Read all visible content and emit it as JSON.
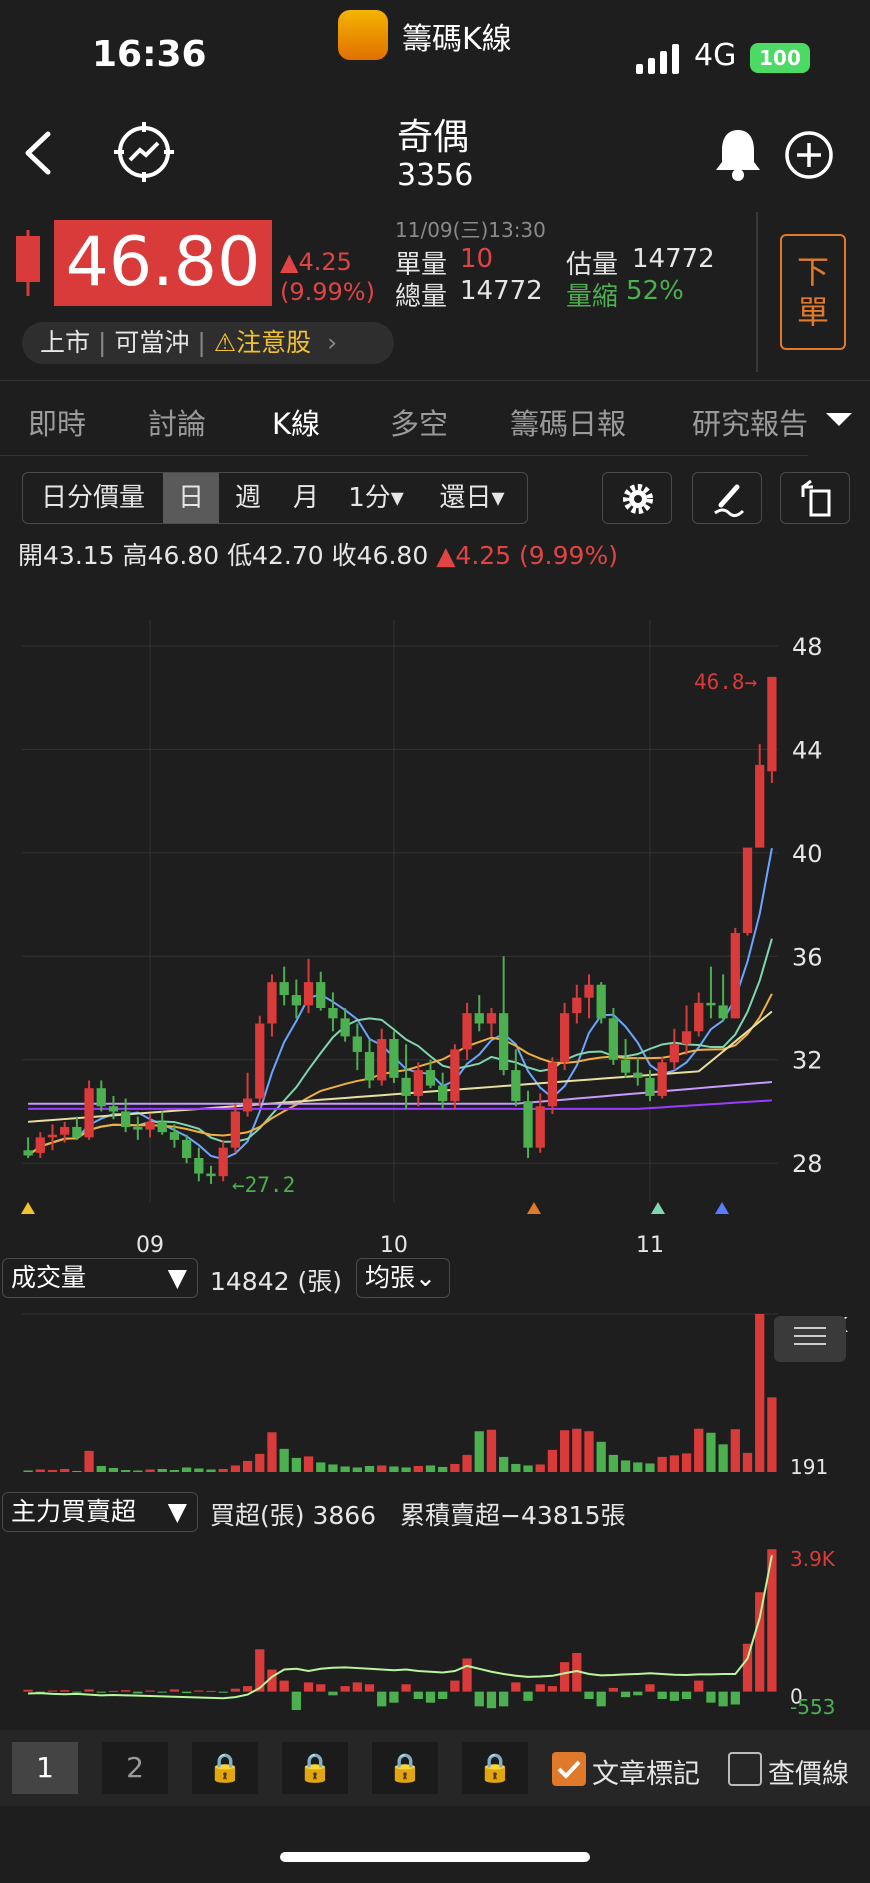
{
  "status_bar": {
    "time": "16:36",
    "app_name": "籌碼K線",
    "network": "4G",
    "battery": "100"
  },
  "header": {
    "stock_name": "奇偶",
    "stock_code": "3356"
  },
  "quote": {
    "price": "46.80",
    "change": "▲4.25",
    "change_pct": "(9.99%)",
    "datetime": "11/09(三)13:30",
    "single_volume_label": "單量",
    "single_volume": "10",
    "total_volume_label": "總量",
    "total_volume": "14772",
    "est_volume_label": "估量",
    "est_volume": "14772",
    "volume_shrink_label": "量縮",
    "volume_shrink": "52%",
    "order_button": "下單",
    "tags": [
      "上市",
      "可當沖",
      "注意股"
    ]
  },
  "tabs": [
    "即時",
    "討論",
    "K線",
    "多空",
    "籌碼日報",
    "研究報告"
  ],
  "active_tab": "K線",
  "toolbar": {
    "items": [
      "日分價量",
      "日",
      "週",
      "月",
      "1分▾",
      "還日▾"
    ],
    "selected": "日"
  },
  "ohlc": {
    "open_label": "開",
    "open": "43.15",
    "high_label": "高",
    "high": "46.80",
    "low_label": "低",
    "low": "42.70",
    "close_label": "收",
    "close": "46.80",
    "change": "▲4.25 (9.99%)"
  },
  "chart_data": [
    {
      "type": "candlestick",
      "y_ticks": [
        "48",
        "44",
        "40",
        "36",
        "32",
        "28"
      ],
      "x_ticks": [
        "09",
        "10",
        "11"
      ],
      "ylim": [
        26.5,
        49
      ],
      "max_label": "46.8",
      "min_label": "27.2",
      "ohlc": [
        [
          28.5,
          29.0,
          28.2,
          28.3
        ],
        [
          28.4,
          29.2,
          28.2,
          29.0
        ],
        [
          29.0,
          29.5,
          28.5,
          29.1
        ],
        [
          29.1,
          29.6,
          28.8,
          29.4
        ],
        [
          29.4,
          29.8,
          28.9,
          29.0
        ],
        [
          29.0,
          31.2,
          28.9,
          30.9
        ],
        [
          30.9,
          31.2,
          30.0,
          30.2
        ],
        [
          30.2,
          30.6,
          29.7,
          30.0
        ],
        [
          30.0,
          30.5,
          29.2,
          29.4
        ],
        [
          29.4,
          29.8,
          28.9,
          29.3
        ],
        [
          29.3,
          29.9,
          29.0,
          29.6
        ],
        [
          29.6,
          30.0,
          29.1,
          29.2
        ],
        [
          29.2,
          29.5,
          28.6,
          28.9
        ],
        [
          28.9,
          29.1,
          28.0,
          28.2
        ],
        [
          28.2,
          28.6,
          27.3,
          27.6
        ],
        [
          27.6,
          27.9,
          27.2,
          27.5
        ],
        [
          27.5,
          28.9,
          27.3,
          28.6
        ],
        [
          28.6,
          30.3,
          28.4,
          30.0
        ],
        [
          30.0,
          31.5,
          29.8,
          30.5
        ],
        [
          30.5,
          33.7,
          30.2,
          33.4
        ],
        [
          33.4,
          35.3,
          32.9,
          35.0
        ],
        [
          35.0,
          35.6,
          34.1,
          34.5
        ],
        [
          34.5,
          35.1,
          33.6,
          34.1
        ],
        [
          34.1,
          35.9,
          33.8,
          35.0
        ],
        [
          35.0,
          35.4,
          33.9,
          34.0
        ],
        [
          34.0,
          34.6,
          33.1,
          33.6
        ],
        [
          33.6,
          34.0,
          32.7,
          32.9
        ],
        [
          32.9,
          33.4,
          31.6,
          32.3
        ],
        [
          32.3,
          32.8,
          30.9,
          31.2
        ],
        [
          31.2,
          33.2,
          31.0,
          32.8
        ],
        [
          32.8,
          33.1,
          31.1,
          31.3
        ],
        [
          31.3,
          32.6,
          30.1,
          30.6
        ],
        [
          30.6,
          31.9,
          30.2,
          31.6
        ],
        [
          31.6,
          32.0,
          30.9,
          31.0
        ],
        [
          31.0,
          31.5,
          30.1,
          30.4
        ],
        [
          30.4,
          32.6,
          30.1,
          32.4
        ],
        [
          32.4,
          34.2,
          32.0,
          33.8
        ],
        [
          33.8,
          34.5,
          33.1,
          33.4
        ],
        [
          33.4,
          34.0,
          32.9,
          33.8
        ],
        [
          33.8,
          36.0,
          31.4,
          31.6
        ],
        [
          31.6,
          32.4,
          30.2,
          30.4
        ],
        [
          30.4,
          30.8,
          28.2,
          28.6
        ],
        [
          28.6,
          30.7,
          28.4,
          30.2
        ],
        [
          30.2,
          32.1,
          29.9,
          31.9
        ],
        [
          31.9,
          34.2,
          31.6,
          33.8
        ],
        [
          33.8,
          34.9,
          33.4,
          34.4
        ],
        [
          34.4,
          35.3,
          33.6,
          34.9
        ],
        [
          34.9,
          35.0,
          33.4,
          33.6
        ],
        [
          33.6,
          34.0,
          31.8,
          32.0
        ],
        [
          32.0,
          32.8,
          31.3,
          31.5
        ],
        [
          31.5,
          32.1,
          31.0,
          31.3
        ],
        [
          31.3,
          31.6,
          30.4,
          30.6
        ],
        [
          30.6,
          32.1,
          30.5,
          31.9
        ],
        [
          31.9,
          33.2,
          31.6,
          32.6
        ],
        [
          32.6,
          34.1,
          32.2,
          33.1
        ],
        [
          33.1,
          34.6,
          32.9,
          34.2
        ],
        [
          34.2,
          35.6,
          33.6,
          34.1
        ],
        [
          34.1,
          35.3,
          33.5,
          33.6
        ],
        [
          33.6,
          37.1,
          33.6,
          36.9
        ],
        [
          36.9,
          40.2,
          36.8,
          40.2
        ],
        [
          40.2,
          44.2,
          41.2,
          43.4
        ],
        [
          43.15,
          46.8,
          42.7,
          46.8
        ]
      ]
    },
    {
      "type": "bar",
      "title": "成交量",
      "summary": "14842 (張)",
      "option": "均張⌄",
      "y_ticks": [
        "31.4K",
        "191"
      ],
      "values": [
        300,
        500,
        400,
        600,
        200,
        4200,
        1200,
        800,
        400,
        300,
        500,
        600,
        400,
        900,
        700,
        500,
        600,
        1300,
        2200,
        3600,
        7900,
        4600,
        2800,
        3100,
        1900,
        1500,
        1100,
        900,
        1200,
        1300,
        1100,
        900,
        1200,
        1300,
        1000,
        1600,
        3400,
        8100,
        8400,
        3000,
        1600,
        1300,
        1500,
        4400,
        8300,
        8600,
        8100,
        6000,
        3400,
        2300,
        1900,
        1700,
        3000,
        3300,
        3700,
        8600,
        7800,
        5500,
        8500,
        3800,
        31400,
        14842
      ]
    },
    {
      "type": "bar",
      "title": "主力買賣超",
      "summary": "買超(張) 3866",
      "cumulative": "累積賣超−43815張",
      "y_ticks": [
        "3.9K",
        "0",
        "-553"
      ],
      "values": [
        50,
        -20,
        30,
        40,
        -10,
        60,
        -30,
        20,
        40,
        -50,
        30,
        -20,
        60,
        -40,
        30,
        20,
        -30,
        80,
        150,
        1150,
        600,
        300,
        -500,
        250,
        200,
        -100,
        150,
        250,
        200,
        -400,
        -300,
        200,
        -200,
        -300,
        -200,
        300,
        900,
        -400,
        -450,
        -400,
        250,
        -250,
        200,
        150,
        800,
        1050,
        -200,
        -400,
        100,
        -150,
        -100,
        200,
        -200,
        -250,
        -200,
        300,
        -300,
        -400,
        -350,
        1300,
        2700,
        3866
      ],
      "line": [
        -50,
        -40,
        -60,
        -70,
        -60,
        -80,
        -100,
        -90,
        -100,
        -110,
        -120,
        -130,
        -140,
        -150,
        -160,
        -170,
        -180,
        -150,
        -80,
        100,
        400,
        600,
        620,
        560,
        620,
        650,
        660,
        640,
        620,
        600,
        580,
        600,
        560,
        540,
        520,
        560,
        700,
        620,
        540,
        480,
        430,
        400,
        410,
        430,
        500,
        560,
        480,
        440,
        450,
        470,
        480,
        500,
        480,
        460,
        450,
        470,
        470,
        480,
        480,
        900,
        2000,
        3700
      ]
    }
  ],
  "markers": [
    "27.2",
    "46.8"
  ],
  "bottom": {
    "pages": [
      "1",
      "2"
    ],
    "selected_page": "1",
    "article_tag_label": "文章標記",
    "article_tag_checked": true,
    "price_line_label": "查價線",
    "price_line_checked": false
  },
  "colors": {
    "up": "#d93a3a",
    "down": "#4caf50",
    "accent": "#e07a2a",
    "warning": "#f2c12e"
  }
}
